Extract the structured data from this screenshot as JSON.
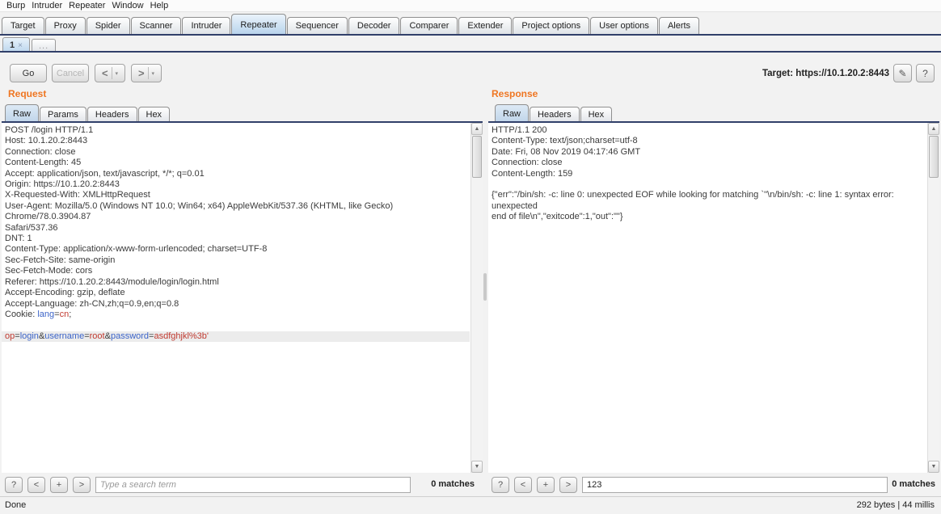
{
  "menu_bar": {
    "items": [
      "Burp",
      "Intruder",
      "Repeater",
      "Window",
      "Help"
    ]
  },
  "main_tabs": {
    "selected": "Repeater",
    "items": [
      "Target",
      "Proxy",
      "Spider",
      "Scanner",
      "Intruder",
      "Repeater",
      "Sequencer",
      "Decoder",
      "Comparer",
      "Extender",
      "Project options",
      "User options",
      "Alerts"
    ]
  },
  "repeater_tabs": {
    "items": [
      {
        "label": "1",
        "close": "×",
        "selected": true
      },
      {
        "label": "...",
        "selected": false
      }
    ]
  },
  "toolbar": {
    "go_label": "Go",
    "cancel_label": "Cancel",
    "prev_icon": "<",
    "next_icon": ">",
    "dropdown_icon": "▾",
    "target_label": "Target:",
    "target_url": "https://10.1.20.2:8443",
    "edit_icon": "✎",
    "help_icon": "?"
  },
  "syntax_colors": {
    "n": "#3b3b3b",
    "b": "#3c64c8",
    "r": "#c03a30"
  },
  "request": {
    "title": "Request",
    "tabs": [
      "Raw",
      "Params",
      "Headers",
      "Hex"
    ],
    "selected_tab": "Raw",
    "highlight_color": "#ececec",
    "lines": [
      {
        "s": [
          [
            "POST /login HTTP/1.1",
            "n"
          ]
        ]
      },
      {
        "s": [
          [
            "Host: 10.1.20.2:8443",
            "n"
          ]
        ]
      },
      {
        "s": [
          [
            "Connection: close",
            "n"
          ]
        ]
      },
      {
        "s": [
          [
            "Content-Length: 45",
            "n"
          ]
        ]
      },
      {
        "s": [
          [
            "Accept: application/json, text/javascript, */*; q=0.01",
            "n"
          ]
        ]
      },
      {
        "s": [
          [
            "Origin: https://10.1.20.2:8443",
            "n"
          ]
        ]
      },
      {
        "s": [
          [
            "X-Requested-With: XMLHttpRequest",
            "n"
          ]
        ]
      },
      {
        "s": [
          [
            "User-Agent: Mozilla/5.0 (Windows NT 10.0; Win64; x64) AppleWebKit/537.36 (KHTML, like Gecko) Chrome/78.0.3904.87",
            "n"
          ]
        ]
      },
      {
        "s": [
          [
            "Safari/537.36",
            "n"
          ]
        ]
      },
      {
        "s": [
          [
            "DNT: 1",
            "n"
          ]
        ]
      },
      {
        "s": [
          [
            "Content-Type: application/x-www-form-urlencoded; charset=UTF-8",
            "n"
          ]
        ]
      },
      {
        "s": [
          [
            "Sec-Fetch-Site: same-origin",
            "n"
          ]
        ]
      },
      {
        "s": [
          [
            "Sec-Fetch-Mode: cors",
            "n"
          ]
        ]
      },
      {
        "s": [
          [
            "Referer: https://10.1.20.2:8443/module/login/login.html",
            "n"
          ]
        ]
      },
      {
        "s": [
          [
            "Accept-Encoding: gzip, deflate",
            "n"
          ]
        ]
      },
      {
        "s": [
          [
            "Accept-Language: zh-CN,zh;q=0.9,en;q=0.8",
            "n"
          ]
        ]
      },
      {
        "s": [
          [
            "Cookie: ",
            "n"
          ],
          [
            "lang",
            "b"
          ],
          [
            "=",
            "n"
          ],
          [
            "cn",
            "r"
          ],
          [
            ";",
            "n"
          ]
        ]
      },
      {
        "s": []
      },
      {
        "hl": true,
        "s": [
          [
            "op",
            "r"
          ],
          [
            "=",
            "n"
          ],
          [
            "login",
            "b"
          ],
          [
            "&",
            "n"
          ],
          [
            "username",
            "b"
          ],
          [
            "=",
            "n"
          ],
          [
            "root",
            "r"
          ],
          [
            "&",
            "n"
          ],
          [
            "password",
            "b"
          ],
          [
            "=",
            "n"
          ],
          [
            "asdfghjkl%3b'",
            "r"
          ]
        ]
      }
    ],
    "search": {
      "help_icon": "?",
      "prev_icon": "<",
      "add_icon": "+",
      "next_icon": ">",
      "placeholder": "Type a search term",
      "value": "",
      "matches": "0 matches"
    }
  },
  "response": {
    "title": "Response",
    "tabs": [
      "Raw",
      "Headers",
      "Hex"
    ],
    "selected_tab": "Raw",
    "lines": [
      {
        "s": [
          [
            "HTTP/1.1 200",
            "n"
          ]
        ]
      },
      {
        "s": [
          [
            "Content-Type: text/json;charset=utf-8",
            "n"
          ]
        ]
      },
      {
        "s": [
          [
            "Date: Fri, 08 Nov 2019 04:17:46 GMT",
            "n"
          ]
        ]
      },
      {
        "s": [
          [
            "Connection: close",
            "n"
          ]
        ]
      },
      {
        "s": [
          [
            "Content-Length: 159",
            "n"
          ]
        ]
      },
      {
        "s": []
      },
      {
        "s": [
          [
            "{\"err\":\"/bin/sh: -c: line 0: unexpected EOF while looking for matching `''\\n/bin/sh: -c: line 1: syntax error: unexpected",
            "n"
          ]
        ]
      },
      {
        "s": [
          [
            "end of file\\n\",\"exitcode\":1,\"out\":\"\"}",
            "n"
          ]
        ]
      }
    ],
    "search": {
      "help_icon": "?",
      "prev_icon": "<",
      "add_icon": "+",
      "next_icon": ">",
      "placeholder": "",
      "value": "123",
      "matches": "0 matches"
    }
  },
  "scrollbar": {
    "up_icon": "▲",
    "down_icon": "▼"
  },
  "status_bar": {
    "left": "Done",
    "right": "292 bytes | 44 millis"
  }
}
